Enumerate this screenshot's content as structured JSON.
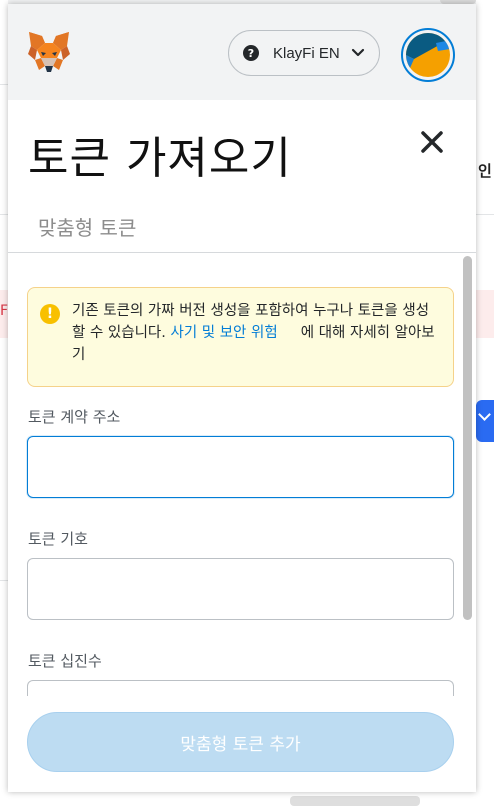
{
  "header": {
    "network_name": "KlayFi EN",
    "help_symbol": "?",
    "logo_icon": "metamask-fox-icon",
    "avatar_icon": "jazzicon-avatar"
  },
  "page": {
    "title": "토큰 가져오기",
    "close_icon": "close-icon",
    "tab_custom": "맞춤형 토큰"
  },
  "warning": {
    "icon": "warning-icon",
    "text_before_link": "기존 토큰의 가짜 버전 생성을 포함하여 누구나 토큰을 생성할 수 있습니다. ",
    "link": "사기 및 보안 위험",
    "text_after_link": "에 대해 자세히 알아보기"
  },
  "form": {
    "contract_address_label": "토큰 계약 주소",
    "contract_address_value": "",
    "symbol_label": "토큰 기호",
    "symbol_value": "",
    "decimals_label": "토큰 십진수"
  },
  "footer": {
    "add_button_label": "맞춤형 토큰 추가"
  },
  "colors": {
    "accent": "#037dd6",
    "button_disabled": "#bddcf2",
    "warning_bg": "#fefcde",
    "warning_border": "#f5d28a",
    "warning_icon": "#f8c000",
    "header_bg": "#f2f3f4"
  }
}
